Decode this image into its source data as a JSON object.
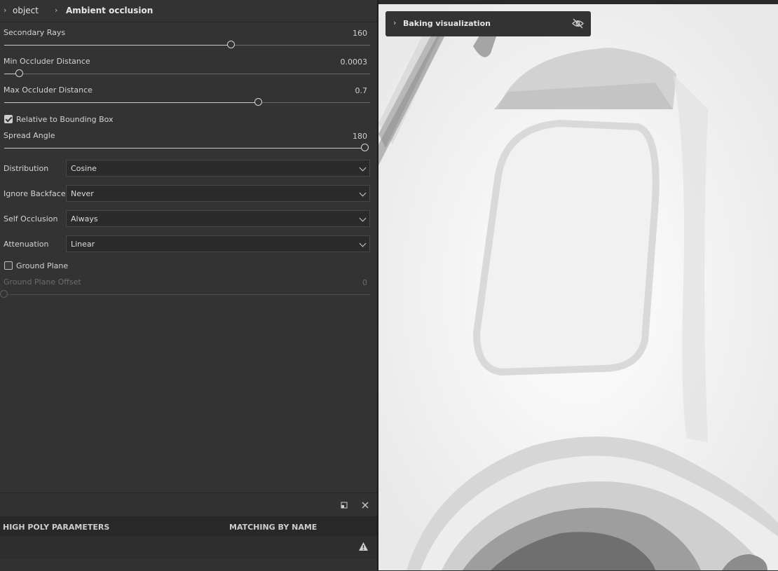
{
  "breadcrumb": {
    "item1": "object",
    "item2": "Ambient occlusion"
  },
  "params": {
    "secondary_rays": {
      "label": "Secondary Rays",
      "value": "160",
      "fraction": 0.62
    },
    "min_occluder": {
      "label": "Min Occluder Distance",
      "value": "0.0003",
      "fraction": 0.042
    },
    "max_occluder": {
      "label": "Max Occluder Distance",
      "value": "0.7",
      "fraction": 0.696
    },
    "relative_bbox": {
      "label": "Relative to Bounding Box",
      "checked": true
    },
    "spread_angle": {
      "label": "Spread Angle",
      "value": "180",
      "fraction": 1.0
    },
    "distribution": {
      "label": "Distribution",
      "selected": "Cosine"
    },
    "ignore_backface": {
      "label": "Ignore Backface",
      "selected": "Never"
    },
    "self_occlusion": {
      "label": "Self Occlusion",
      "selected": "Always"
    },
    "attenuation": {
      "label": "Attenuation",
      "selected": "Linear"
    },
    "ground_plane": {
      "label": "Ground Plane",
      "checked": false
    },
    "ground_plane_offset": {
      "label": "Ground Plane Offset",
      "value": "0",
      "fraction": 0.0
    }
  },
  "bottom_panel": {
    "col1": "HIGH POLY PARAMETERS",
    "col2": "MATCHING BY NAME"
  },
  "viewport": {
    "overlay_title": "Baking visualization"
  },
  "icons": {
    "chevron": "chevron-right-icon",
    "dropdown": "chevron-down-icon",
    "float": "undock-icon",
    "close": "close-icon",
    "warning": "warning-icon",
    "visibility": "eye-off-icon"
  },
  "colors": {
    "panel": "#333333",
    "accent": "#d4d4d4",
    "viewport": "#f4f4f4"
  }
}
